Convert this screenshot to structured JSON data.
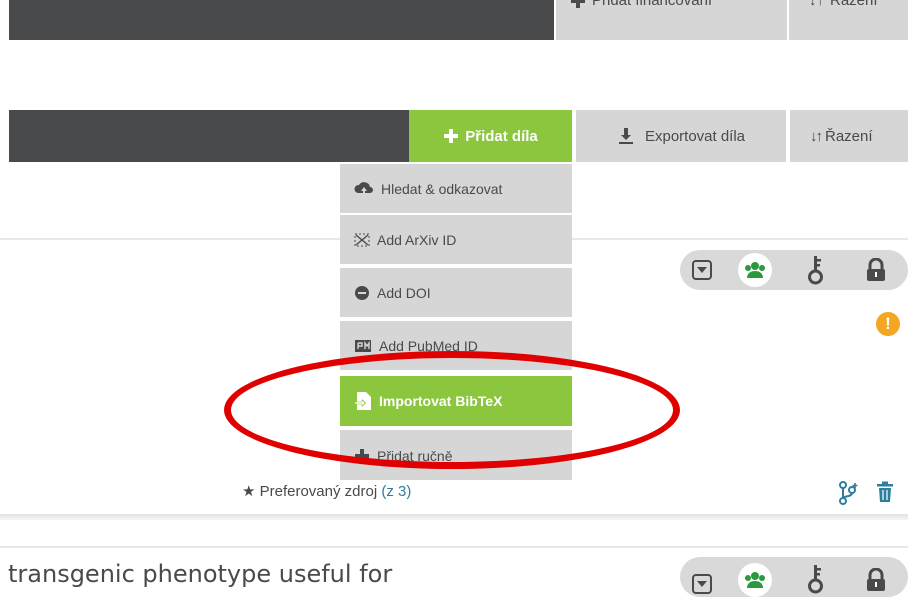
{
  "top_toolbar": {
    "add_funding_label": "Přidat financování",
    "sort_label": "Řazení"
  },
  "works_toolbar": {
    "add_works_label": "Přidat díla",
    "export_label": "Exportovat díla",
    "sort_label": "Řazení"
  },
  "add_menu": {
    "items": [
      {
        "label": "Hledat & odkazovat",
        "icon": "cloud-upload-icon"
      },
      {
        "label": "Add ArXiv ID",
        "icon": "arxiv-icon"
      },
      {
        "label": "Add DOI",
        "icon": "doi-icon"
      },
      {
        "label": "Add PubMed ID",
        "icon": "pubmed-icon"
      },
      {
        "label": "Importovat BibTeX",
        "icon": "import-file-icon",
        "active": true
      },
      {
        "label": "Přidat ručně",
        "icon": "plus-icon"
      }
    ]
  },
  "work_item": {
    "preferred_source_prefix": "★ Preferovaný zdroj",
    "preferred_source_count": "(z 3)",
    "warning_symbol": "!"
  },
  "next_work_item": {
    "title": "transgenic phenotype useful for"
  },
  "colors": {
    "accent_green": "#8cc63f",
    "toolbar_dark": "#494a4c",
    "button_gray": "#d6d6d6",
    "annotation_red": "#e00000",
    "link_blue": "#2e7f9d",
    "warning_orange": "#f5a623"
  }
}
